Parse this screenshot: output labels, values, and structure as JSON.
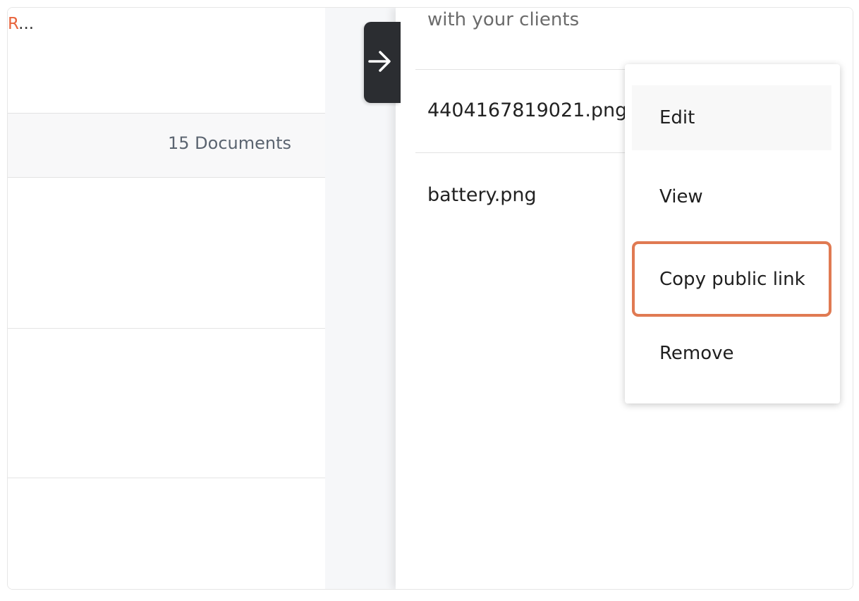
{
  "left_panel": {
    "truncated_title_accent": "R",
    "truncated_title_rest": "...",
    "doc_count": "15 Documents"
  },
  "drawer": {
    "subtitle": "with your clients",
    "files": [
      {
        "name": "4404167819021.png"
      },
      {
        "name": "battery.png"
      }
    ]
  },
  "context_menu": {
    "items": [
      {
        "label": "Edit"
      },
      {
        "label": "View"
      },
      {
        "label": "Copy public link"
      },
      {
        "label": "Remove"
      }
    ]
  },
  "colors": {
    "accent": "#e8643c",
    "highlight_border": "#e07a52",
    "tab_background": "#2b2d31"
  },
  "icons": {
    "collapse_tab": "arrow-right-icon"
  }
}
